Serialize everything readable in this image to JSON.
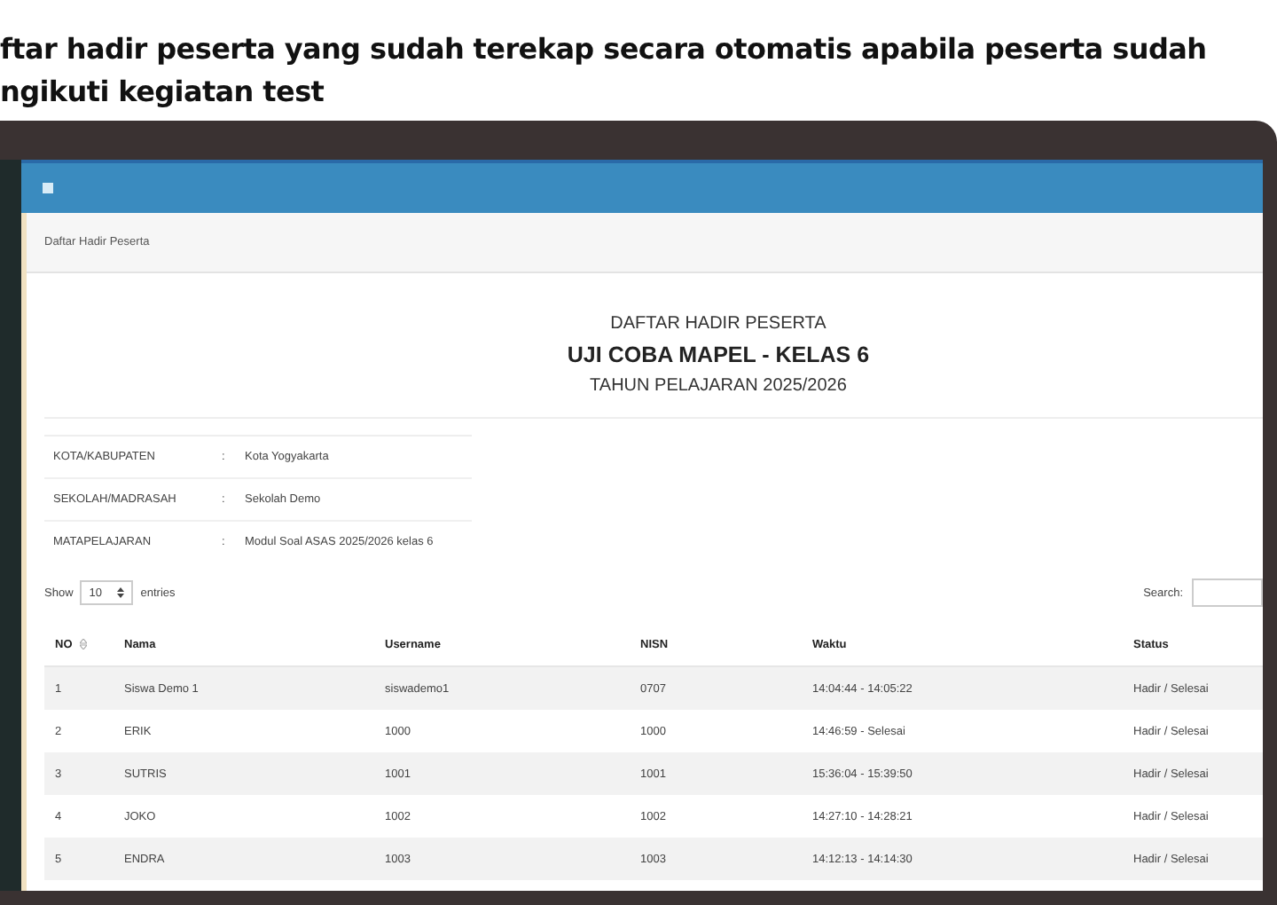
{
  "caption": [
    "ftar hadir peserta yang sudah terekap secara otomatis apabila peserta sudah",
    "ngikuti kegiatan test"
  ],
  "breadcrumb": "Daftar Hadir Peserta",
  "heading": {
    "title": "DAFTAR HADIR PESERTA",
    "subtitle": "UJI COBA MAPEL - KELAS 6",
    "year": "TAHUN PELAJARAN 2025/2026"
  },
  "info": [
    {
      "label": "KOTA/KABUPATEN",
      "separator": ":",
      "value": "Kota Yogyakarta"
    },
    {
      "label": "SEKOLAH/MADRASAH",
      "separator": ":",
      "value": "Sekolah Demo"
    },
    {
      "label": "MATAPELAJARAN",
      "separator": ":",
      "value": "Modul Soal ASAS 2025/2026 kelas 6"
    }
  ],
  "length_menu": {
    "prefix": "Show",
    "value": "10",
    "suffix": "entries"
  },
  "search": {
    "label": "Search:"
  },
  "table": {
    "columns": [
      "NO",
      "Nama",
      "Username",
      "NISN",
      "Waktu",
      "Status"
    ],
    "rows": [
      [
        "1",
        "Siswa Demo 1",
        "siswademo1",
        "0707",
        "14:04:44 - 14:05:22",
        "Hadir / Selesai"
      ],
      [
        "2",
        "ERIK",
        "1000",
        "1000",
        "14:46:59 - Selesai",
        "Hadir / Selesai"
      ],
      [
        "3",
        "SUTRIS",
        "1001",
        "1001",
        "15:36:04 - 15:39:50",
        "Hadir / Selesai"
      ],
      [
        "4",
        "JOKO",
        "1002",
        "1002",
        "14:27:10 - 14:28:21",
        "Hadir / Selesai"
      ],
      [
        "5",
        "ENDRA",
        "1003",
        "1003",
        "14:12:13 - 14:14:30",
        "Hadir / Selesai"
      ]
    ]
  }
}
